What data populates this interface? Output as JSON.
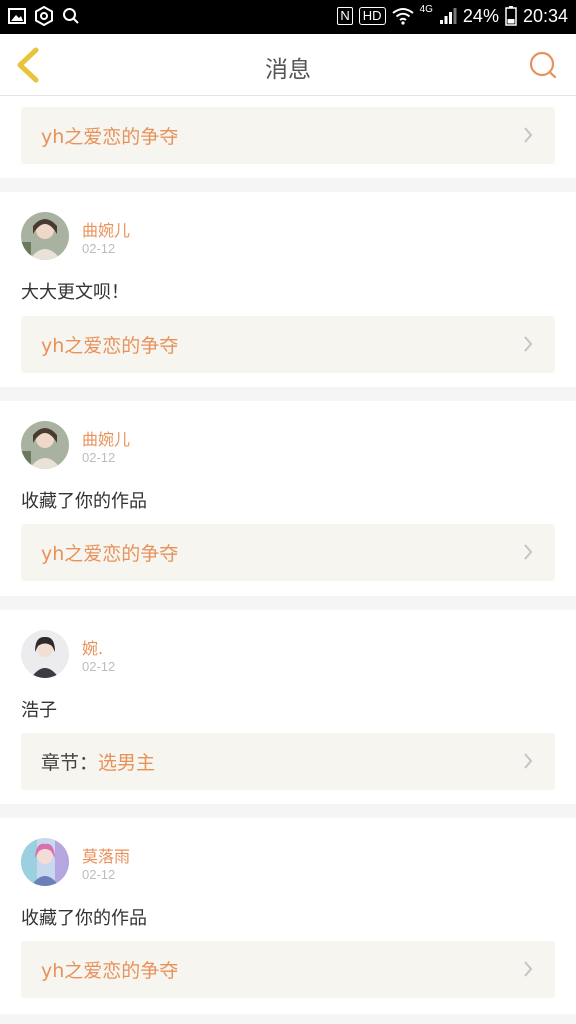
{
  "statusbar": {
    "hd_label": "HD",
    "network_label": "4G",
    "nfc_label": "N",
    "battery_percent": "24%",
    "time": "20:34"
  },
  "navbar": {
    "title": "消息"
  },
  "top_link": {
    "text": "yh之爱恋的争夺"
  },
  "messages": [
    {
      "user": "曲婉儿",
      "date": "02-12",
      "content": "大大更文呗！",
      "link_prefix": "",
      "link_text": "yh之爱恋的争夺"
    },
    {
      "user": "曲婉儿",
      "date": "02-12",
      "content": "收藏了你的作品",
      "link_prefix": "",
      "link_text": "yh之爱恋的争夺"
    },
    {
      "user": "婉.",
      "date": "02-12",
      "content": "浩子",
      "link_prefix": "章节：",
      "link_text": "选男主"
    },
    {
      "user": "莫落雨",
      "date": "02-12",
      "content": "收藏了你的作品",
      "link_prefix": "",
      "link_text": "yh之爱恋的争夺"
    }
  ],
  "colors": {
    "accent": "#e8925b",
    "back_arrow": "#e8c43a",
    "link_bg": "#f6f5ef"
  }
}
